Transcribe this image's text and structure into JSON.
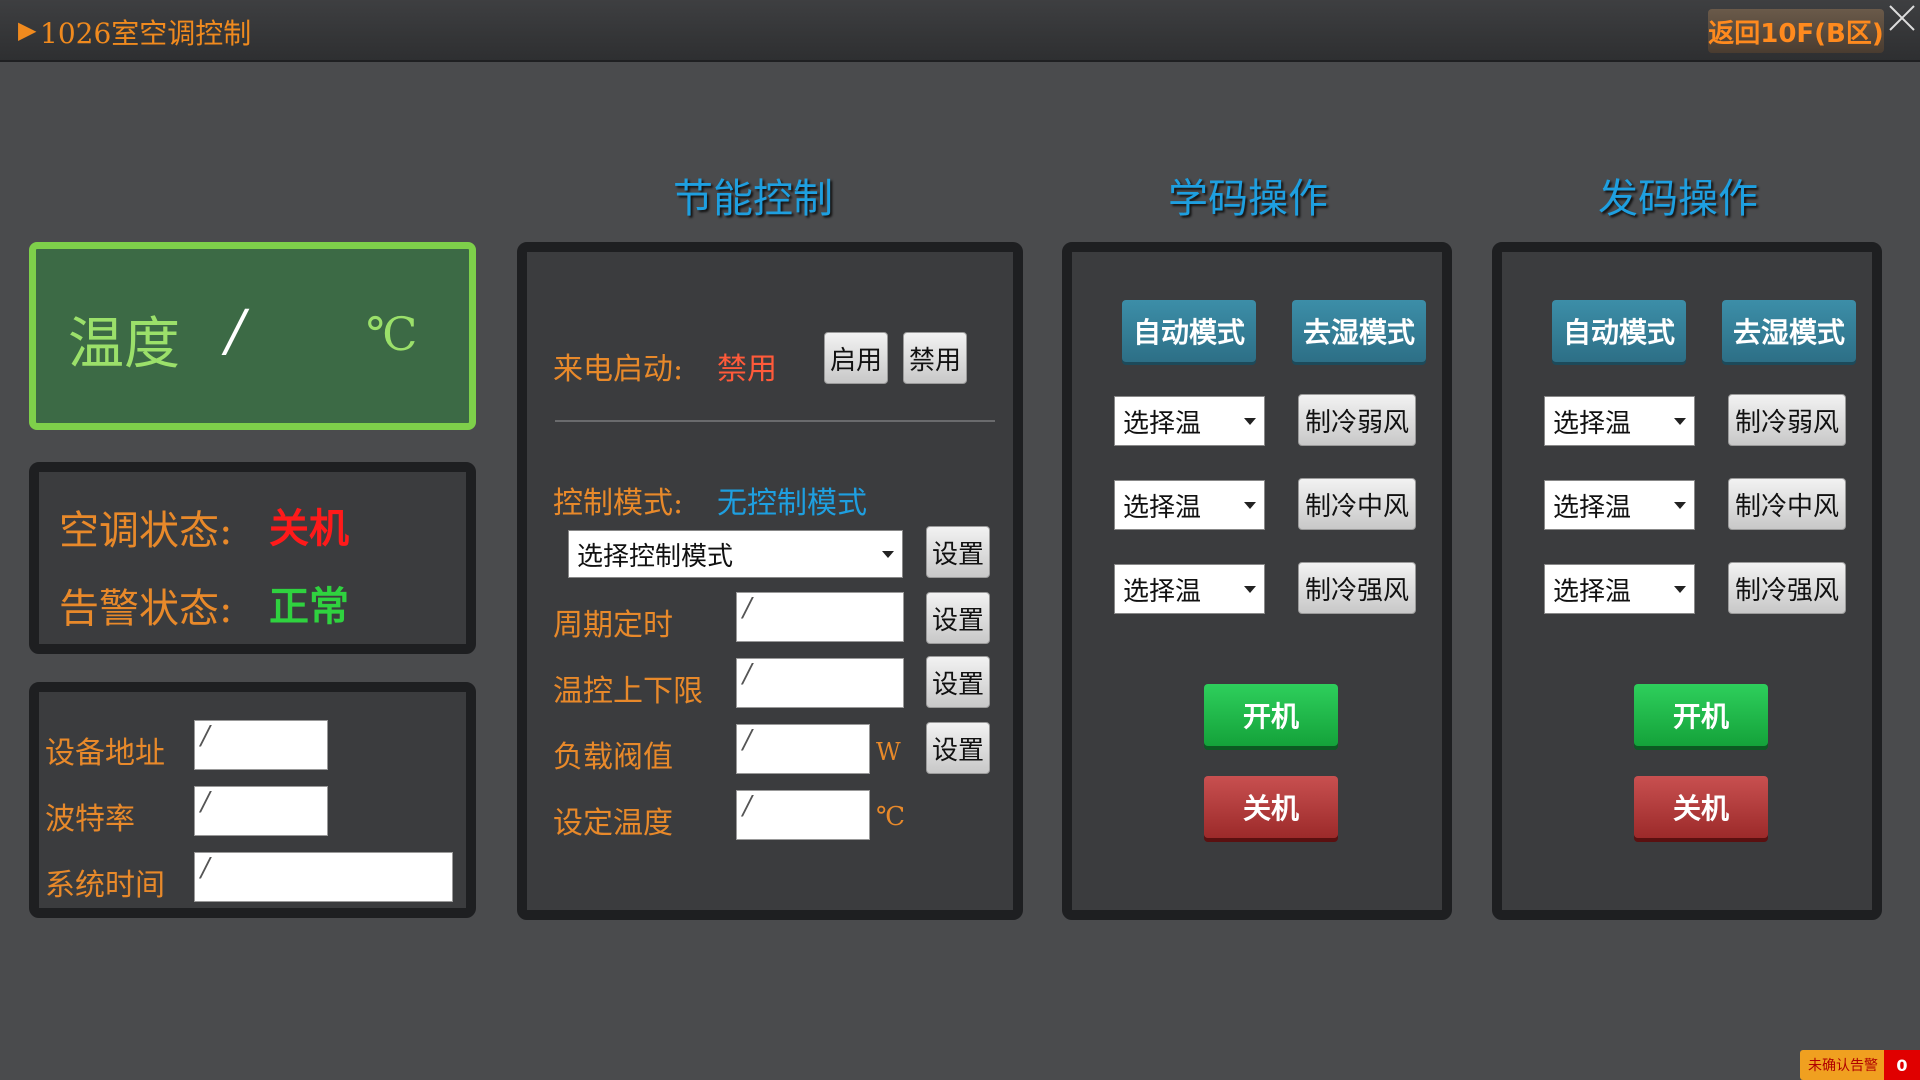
{
  "window": {
    "title_arrow": "▶",
    "title": "1026室空调控制",
    "back_label": "返回10F(B区)"
  },
  "sections": {
    "energy_title": "节能控制",
    "learn_title": "学码操作",
    "send_title": "发码操作"
  },
  "temperature": {
    "label": "温度",
    "value": "/",
    "unit": "℃"
  },
  "status": {
    "ac_label": "空调状态:",
    "ac_value": "关机",
    "alarm_label": "告警状态:",
    "alarm_value": "正常",
    "ac_value_color": "#ff1a1a",
    "alarm_value_color": "#2fd23f"
  },
  "device": {
    "address_label": "设备地址",
    "address_value": "/",
    "baud_label": "波特率",
    "baud_value": "/",
    "time_label": "系统时间",
    "time_value": "/"
  },
  "energy": {
    "power_on_label": "来电启动:",
    "power_on_value": "禁用",
    "enable_label": "启用",
    "disable_label": "禁用",
    "mode_label": "控制模式:",
    "mode_value": "无控制模式",
    "mode_select": "选择控制模式",
    "set_label": "设置",
    "period_label": "周期定时",
    "period_value": "/",
    "temp_range_label": "温控上下限",
    "temp_range_value": "/",
    "load_label": "负载阀值",
    "load_value": "/",
    "load_unit": "W",
    "set_temp_label": "设定温度",
    "set_temp_value": "/",
    "set_temp_unit": "℃"
  },
  "learn": {
    "auto_label": "自动模式",
    "dehum_label": "去湿模式",
    "select_label": "选择温",
    "cool_weak": "制冷弱风",
    "cool_mid": "制冷中风",
    "cool_strong": "制冷强风",
    "on_label": "开机",
    "off_label": "关机"
  },
  "send": {
    "auto_label": "自动模式",
    "dehum_label": "去湿模式",
    "select_label": "选择温",
    "cool_weak": "制冷弱风",
    "cool_mid": "制冷中风",
    "cool_strong": "制冷强风",
    "on_label": "开机",
    "off_label": "关机"
  },
  "alarm_badge": {
    "label": "未确认告警",
    "count": "0"
  }
}
